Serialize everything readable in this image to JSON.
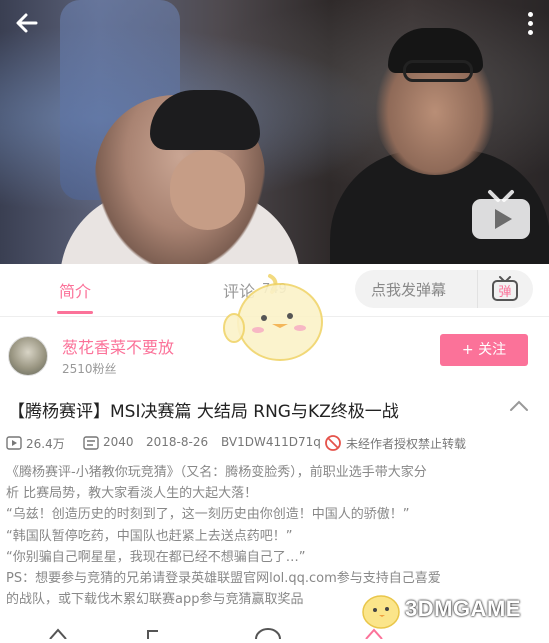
{
  "video": {
    "danmaku_icon": "danmaku-toggle-icon",
    "back_icon": "back-arrow-icon",
    "more_icon": "more-vertical-icon",
    "play_icon": "tv-play-icon"
  },
  "tabs": [
    {
      "label": "简介",
      "active": true
    },
    {
      "label": "评论",
      "active": false
    },
    {
      "label": "749",
      "active": false
    }
  ],
  "danmaku": {
    "placeholder": "点我发弹幕",
    "button_label": "弹"
  },
  "uploader": {
    "name": "葱花香菜不要放",
    "fans": "2510粉丝",
    "follow_label": "+ 关注"
  },
  "video_info": {
    "title": "【腾杨赛评】MSI决赛篇 大结局 RNG与KZ终极一战",
    "views": "26.4万",
    "danmaku_count": "2040",
    "date": "2018-8-26",
    "bvid": "BV1DW411D71q",
    "copyright": "未经作者授权禁止转载"
  },
  "description": [
    "《腾杨赛评-小猪教你玩竞猜》（又名：腾杨变脸秀），前职业选手带大家分",
    "析 比赛局势，教大家看淡人生的大起大落！",
    "“乌兹！创造历史的时刻到了，这一刻历史由你创造！中国人的骄傲！”",
    "“韩国队暂停吃药，中国队也赶紧上去送点药吧！”",
    "“你别骗自己啊星星，我现在都已经不想骗自己了…”",
    "PS：想要参与竞猜的兄弟请登录英雄联盟官网lol.qq.com参与支持自己喜爱",
    "的战队，或下载伐木累幻联赛app参与竞猜赢取奖品"
  ],
  "watermark": "3DMGAME",
  "colors": {
    "accent": "#fb7299"
  }
}
